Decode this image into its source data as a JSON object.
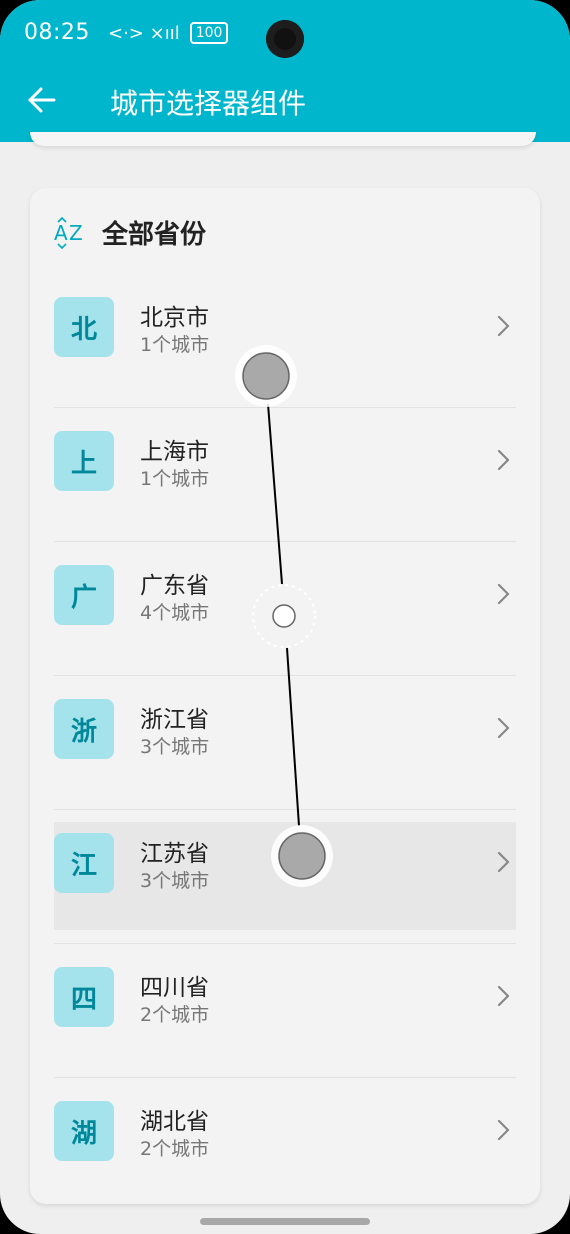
{
  "status_bar": {
    "time": "08:25",
    "signal_text": "<·> ×ııl",
    "battery": "100"
  },
  "app_bar": {
    "title": "城市选择器组件"
  },
  "card": {
    "title": "全部省份",
    "items": [
      {
        "badge": "北",
        "name": "北京市",
        "count": "1个城市"
      },
      {
        "badge": "上",
        "name": "上海市",
        "count": "1个城市"
      },
      {
        "badge": "广",
        "name": "广东省",
        "count": "4个城市"
      },
      {
        "badge": "浙",
        "name": "浙江省",
        "count": "3个城市"
      },
      {
        "badge": "江",
        "name": "江苏省",
        "count": "3个城市"
      },
      {
        "badge": "四",
        "name": "四川省",
        "count": "2个城市"
      },
      {
        "badge": "湖",
        "name": "湖北省",
        "count": "2个城市"
      }
    ]
  },
  "colors": {
    "primary": "#00b6cc",
    "badge_bg": "#a4e3ec",
    "badge_text": "#00879a"
  },
  "icons": {
    "back": "arrow-left-icon",
    "sort": "sort-az-icon",
    "chevron": "chevron-right-icon"
  }
}
